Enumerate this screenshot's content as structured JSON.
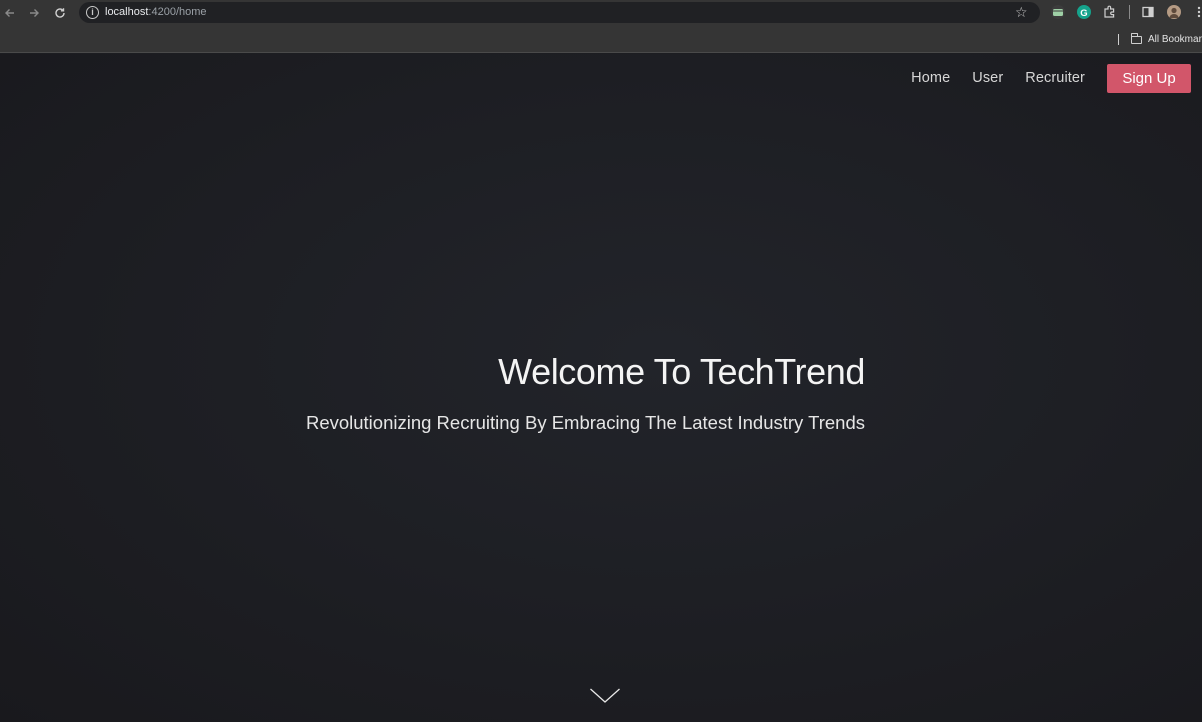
{
  "browser": {
    "url_host": "localhost",
    "url_rest": ":4200/home",
    "bookmarks_label": "All Bookmarks",
    "icons": [
      "back-icon",
      "forward-icon",
      "reload-icon",
      "site-info-icon",
      "star-icon",
      "extension-icon",
      "grammarly-icon",
      "puzzle-icon",
      "side-panel-icon",
      "profile-avatar",
      "more-menu-icon",
      "folder-icon"
    ]
  },
  "nav": {
    "links": [
      "Home",
      "User",
      "Recruiter"
    ],
    "signup_label": "Sign Up"
  },
  "hero": {
    "title": "Welcome To TechTrend",
    "subtitle": "Revolutionizing Recruiting By Embracing The Latest Industry Trends"
  },
  "colors": {
    "page_background": "#1c1d21",
    "accent": "#d2566a",
    "text": "#f4f4f4"
  }
}
